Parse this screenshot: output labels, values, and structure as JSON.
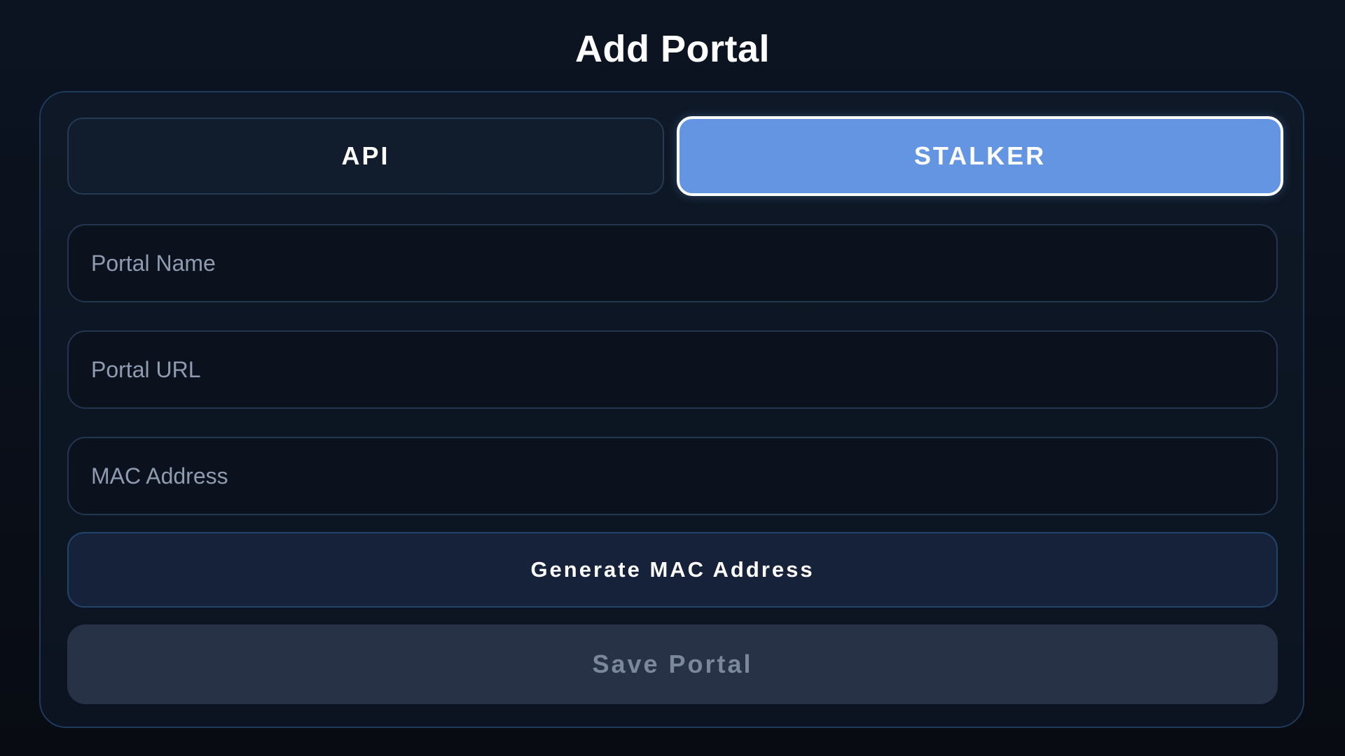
{
  "page": {
    "title": "Add Portal"
  },
  "portal_type_tabs": [
    {
      "label": "API",
      "selected": false
    },
    {
      "label": "STALKER",
      "selected": true
    }
  ],
  "form": {
    "portal_name": {
      "value": "",
      "placeholder": "Portal Name"
    },
    "portal_url": {
      "value": "",
      "placeholder": "Portal URL"
    },
    "mac_address": {
      "value": "",
      "placeholder": "MAC Address"
    }
  },
  "buttons": {
    "generate_mac_label": "Generate MAC Address",
    "save_label": "Save Portal",
    "save_enabled": false
  },
  "colors": {
    "background": "#0a0f18",
    "accent_selected": "#6495e2",
    "card_border": "#1e3a5c",
    "disabled_button": "#273246"
  }
}
